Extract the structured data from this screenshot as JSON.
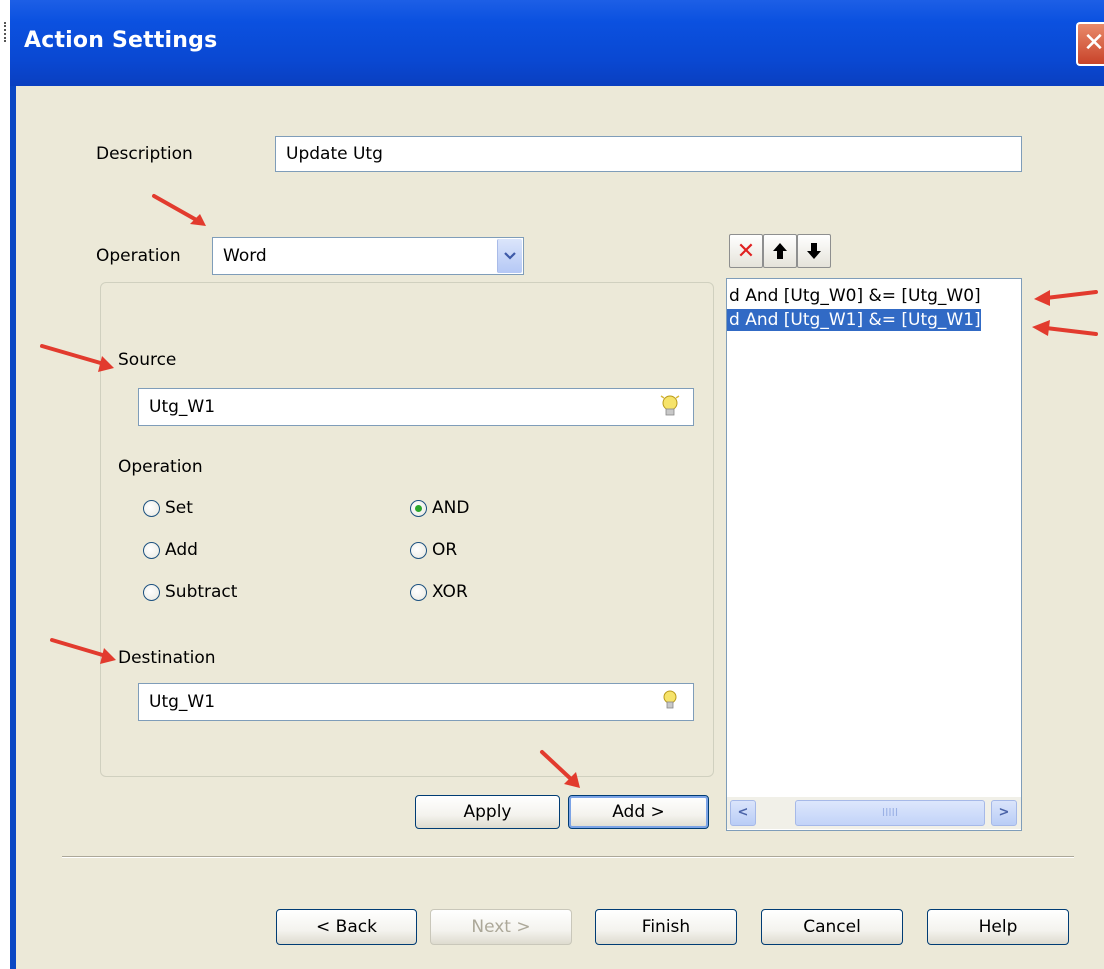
{
  "window": {
    "title": "Action Settings",
    "close_glyph": "✕"
  },
  "description": {
    "label": "Description",
    "value": "Update Utg"
  },
  "operation_combo": {
    "label": "Operation",
    "value": "Word",
    "dropdown_icon": "chevron-down-icon"
  },
  "source": {
    "label": "Source",
    "value": "Utg_W1",
    "icon": "lightbulb-icon"
  },
  "operation_group": {
    "label": "Operation",
    "options": [
      {
        "label": "Set",
        "selected": false
      },
      {
        "label": "Add",
        "selected": false
      },
      {
        "label": "Subtract",
        "selected": false
      },
      {
        "label": "AND",
        "selected": true
      },
      {
        "label": "OR",
        "selected": false
      },
      {
        "label": "XOR",
        "selected": false
      }
    ]
  },
  "destination": {
    "label": "Destination",
    "value": "Utg_W1",
    "icon": "lightbulb-icon"
  },
  "actions": {
    "apply_label": "Apply",
    "add_label": "Add >"
  },
  "toolbar": {
    "delete_glyph": "✕",
    "up_glyph": "🡑",
    "down_glyph": "🡓"
  },
  "action_list": {
    "items": [
      {
        "text": "d And [Utg_W0] &= [Utg_W0]",
        "selected": false
      },
      {
        "text": "d And [Utg_W1] &= [Utg_W1]",
        "selected": true
      }
    ],
    "scroll_left": "<",
    "scroll_right": ">",
    "thumb_grip": "IIIII"
  },
  "footer": {
    "back_label": "< Back",
    "next_label": "Next >",
    "finish_label": "Finish",
    "cancel_label": "Cancel",
    "help_label": "Help"
  },
  "colors": {
    "titlebar": "#0a48d2",
    "dialog_bg": "#ece9d8",
    "selection": "#316ac5",
    "arrow": "#e23b2e",
    "delete_icon": "#e02020"
  }
}
